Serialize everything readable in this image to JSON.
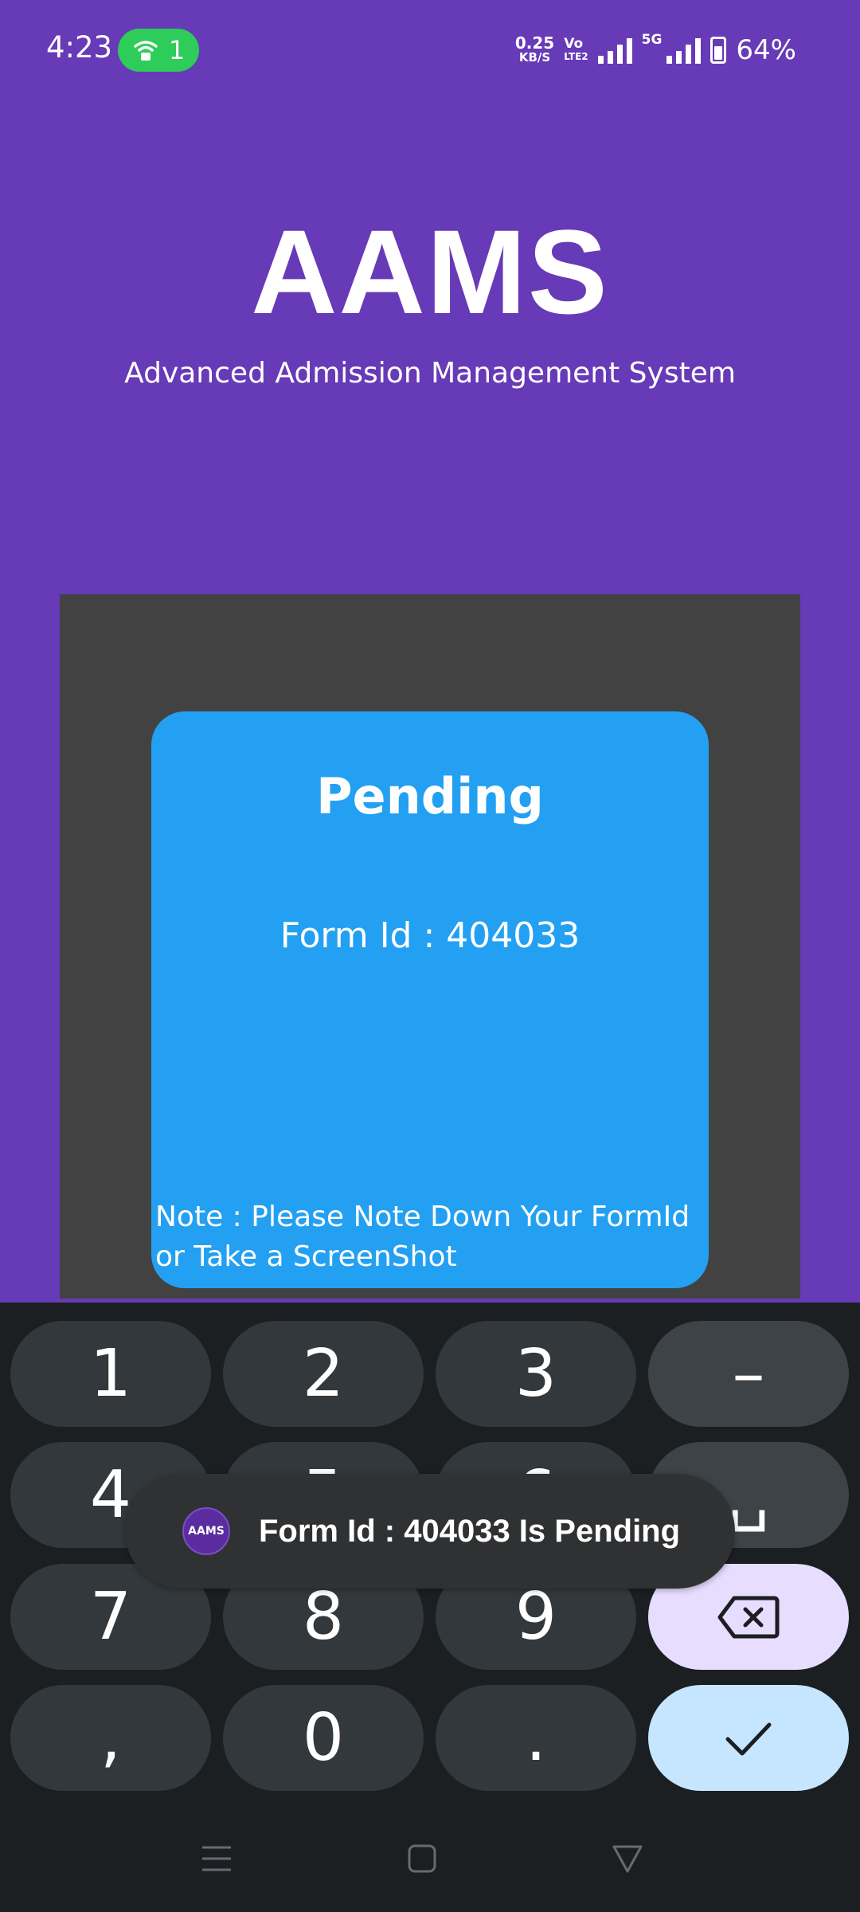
{
  "status_bar": {
    "time": "4:23",
    "hotspot_count": "1",
    "speed_value": "0.25",
    "speed_unit": "KB/S",
    "volte_top": "Vo",
    "volte_bottom": "LTE2",
    "network": "5G",
    "battery": "64%"
  },
  "header": {
    "title": "AAMS",
    "subtitle": "Advanced Admission Management System"
  },
  "status_card": {
    "title": "Pending",
    "form_id": "Form Id : 404033",
    "note": "Note : Please Note Down Your FormId or Take a ScreenShot"
  },
  "keyboard": {
    "row1": [
      "1",
      "2",
      "3",
      "–"
    ],
    "row2": [
      "4",
      "5",
      "6",
      "␣"
    ],
    "row3": [
      "7",
      "8",
      "9"
    ],
    "row4": [
      ",",
      "0",
      "."
    ]
  },
  "toast": {
    "icon_text": "AAMS",
    "message": "Form Id : 404033 Is Pending"
  },
  "colors": {
    "background": "#673ab7",
    "card": "#23a0f2",
    "dialog": "#424242",
    "keyboard": "#1b1f22"
  },
  "icons": {
    "hotspot": "hotspot-icon",
    "backspace": "backspace-icon",
    "done": "checkmark-icon",
    "nav_menu": "menu-icon",
    "nav_home": "home-icon",
    "nav_back": "back-icon"
  }
}
